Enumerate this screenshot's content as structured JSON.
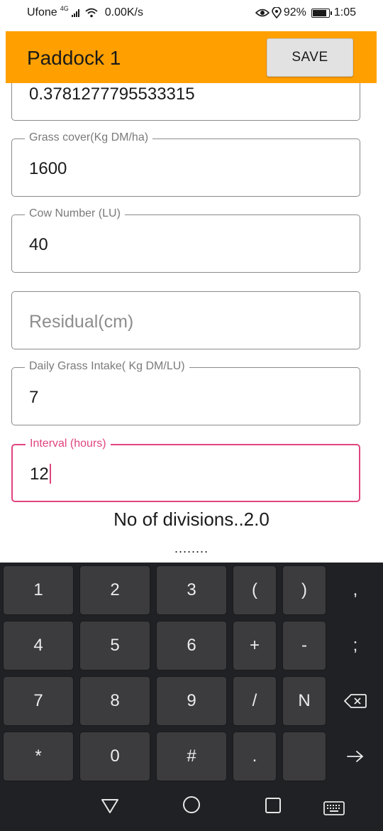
{
  "status_bar": {
    "carrier": "Ufone",
    "network": "4G",
    "speed": "0.00K/s",
    "battery": "92%",
    "time": "1:05"
  },
  "app_bar": {
    "title": "Paddock 1",
    "save_label": "SAVE",
    "background": "#ffa000"
  },
  "fields": {
    "top_partial": {
      "value": "0.3781277795533315"
    },
    "grass_cover": {
      "label": "Grass cover(Kg DM/ha)",
      "value": "1600"
    },
    "cow_number": {
      "label": "Cow Number (LU)",
      "value": "40"
    },
    "residual": {
      "placeholder": "Residual(cm)"
    },
    "daily_intake": {
      "label": "Daily Grass Intake( Kg DM/LU)",
      "value": "7"
    },
    "interval": {
      "label": "Interval (hours)",
      "value": "12"
    }
  },
  "result": {
    "divisions_text": "No of divisions..2.0",
    "dots": "........"
  },
  "keyboard": {
    "rows": [
      [
        "1",
        "2",
        "3",
        "(",
        ")",
        ","
      ],
      [
        "4",
        "5",
        "6",
        "+",
        "-",
        ";"
      ],
      [
        "7",
        "8",
        "9",
        "/",
        "N",
        ""
      ],
      [
        "*",
        "0",
        "#",
        ".",
        "",
        ""
      ]
    ],
    "icons": [
      "backspace-icon",
      "enter-arrow-icon"
    ]
  },
  "nav_bar": {
    "icons": [
      "back-icon",
      "home-icon",
      "recents-icon",
      "keyboard-switch-icon"
    ]
  },
  "colors": {
    "accent_active": "#e0457f",
    "keyboard_bg": "#202124",
    "key_bg": "#3c3c3f"
  }
}
